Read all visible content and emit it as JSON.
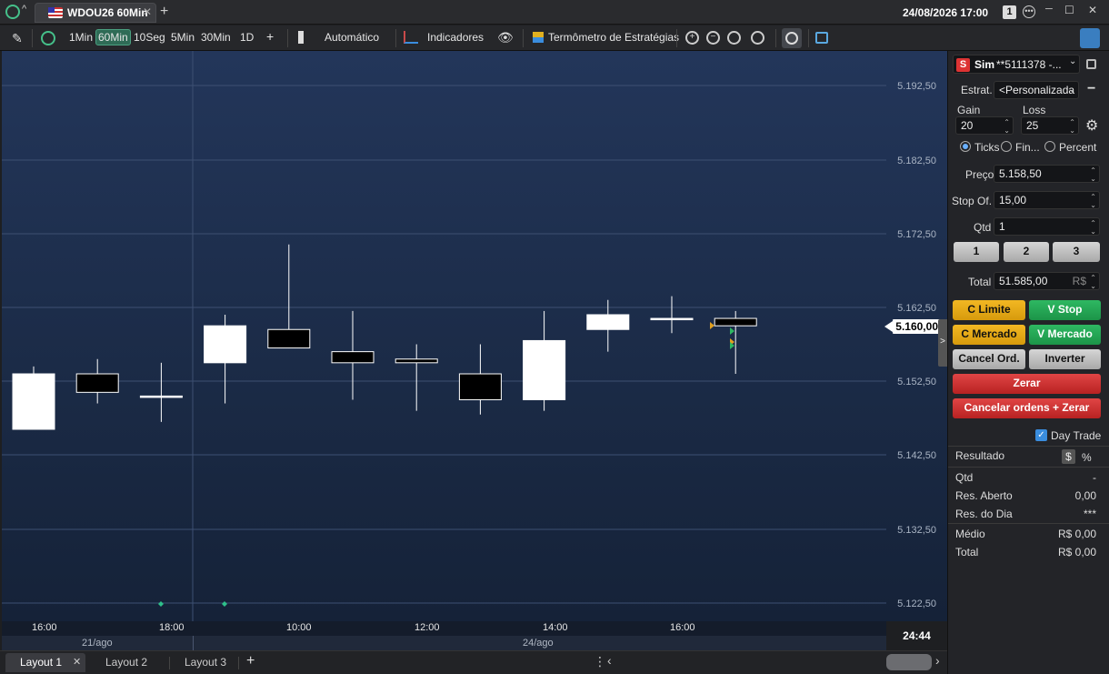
{
  "window": {
    "tab_title": "WDOU26 60Min",
    "datetime": "24/08/2026 17:00",
    "window_count": "1",
    "new_tab": "+",
    "minimize": "─",
    "maximize": "☐",
    "close": "✕"
  },
  "toolbar": {
    "intervals": [
      "1Min",
      "60Min",
      "10Seg",
      "5Min",
      "30Min",
      "1D"
    ],
    "selected_interval": "60Min",
    "add": "+",
    "auto_label": "Automático",
    "indicators_label": "Indicadores",
    "strategy_label": "Termômetro de Estratégias"
  },
  "chart_data": {
    "type": "candlestick",
    "y_ticks": [
      "5.192,50",
      "5.182,50",
      "5.172,50",
      "5.162,50",
      "5.152,50",
      "5.142,50",
      "5.132,50",
      "5.122,50"
    ],
    "x_ticks": [
      "16:00",
      "18:00",
      "10:00",
      "12:00",
      "14:00",
      "16:00"
    ],
    "date_labels": [
      "21/ago",
      "24/ago"
    ],
    "last_price": "5.160,00",
    "timer": "24:44",
    "candles": [
      {
        "open": 5146.0,
        "high": 5154.5,
        "low": 5146.0,
        "close": 5153.5
      },
      {
        "open": 5153.5,
        "high": 5155.5,
        "low": 5149.5,
        "close": 5151.0
      },
      {
        "open": 5150.5,
        "high": 5155.0,
        "low": 5147.0,
        "close": 5150.5
      },
      {
        "open": 5155.0,
        "high": 5161.5,
        "low": 5149.5,
        "close": 5160.0
      },
      {
        "open": 5159.5,
        "high": 5171.0,
        "low": 5157.5,
        "close": 5157.0
      },
      {
        "open": 5156.5,
        "high": 5162.0,
        "low": 5150.0,
        "close": 5155.0
      },
      {
        "open": 5155.5,
        "high": 5157.5,
        "low": 5148.5,
        "close": 5155.0
      },
      {
        "open": 5153.5,
        "high": 5157.5,
        "low": 5148.0,
        "close": 5150.0
      },
      {
        "open": 5150.0,
        "high": 5162.0,
        "low": 5148.5,
        "close": 5158.0
      },
      {
        "open": 5159.5,
        "high": 5163.5,
        "low": 5156.5,
        "close": 5161.5
      },
      {
        "open": 5161.0,
        "high": 5164.0,
        "low": 5159.0,
        "close": 5161.0
      },
      {
        "open": 5161.0,
        "high": 5162.0,
        "low": 5153.5,
        "close": 5160.0
      }
    ],
    "ylim": [
      5120.0,
      5197.0
    ]
  },
  "layout_tabs": [
    "Layout 1",
    "Layout 2",
    "Layout 3"
  ],
  "layout_add": "+",
  "panel": {
    "account_badge": "S",
    "account_type": "Sim",
    "account_id": "**5111378 -...",
    "strategy_label": "Estrat.",
    "strategy_value": "<Personalizada",
    "gain_label": "Gain",
    "gain_value": "20",
    "loss_label": "Loss",
    "loss_value": "25",
    "radio_ticks": "Ticks",
    "radio_fin": "Fin...",
    "radio_percent": "Percent",
    "price_label": "Preço",
    "price_value": "5.158,50",
    "stop_label": "Stop Of.",
    "stop_value": "15,00",
    "qty_label": "Qtd",
    "qty_value": "1",
    "qty_presets": [
      "1",
      "2",
      "3"
    ],
    "total_label": "Total",
    "total_value": "51.585,00",
    "total_currency": "R$",
    "btn_buy_limit": "C Limite",
    "btn_sell_stop": "V Stop",
    "btn_buy_market": "C Mercado",
    "btn_sell_market": "V Mercado",
    "btn_cancel": "Cancel Ord.",
    "btn_invert": "Inverter",
    "btn_zero": "Zerar",
    "btn_cancel_zero": "Cancelar ordens + Zerar",
    "daytrade_label": "Day Trade",
    "result_label": "Resultado",
    "result_currency_btn": "$",
    "result_percent_btn": "%",
    "rows": [
      {
        "label": "Qtd",
        "value": "-"
      },
      {
        "label": "Res. Aberto",
        "value": "0,00"
      },
      {
        "label": "Res. do Dia",
        "value": "***"
      },
      {
        "label": "Médio",
        "value": "R$ 0,00"
      },
      {
        "label": "Total",
        "value": "R$ 0,00"
      }
    ]
  }
}
